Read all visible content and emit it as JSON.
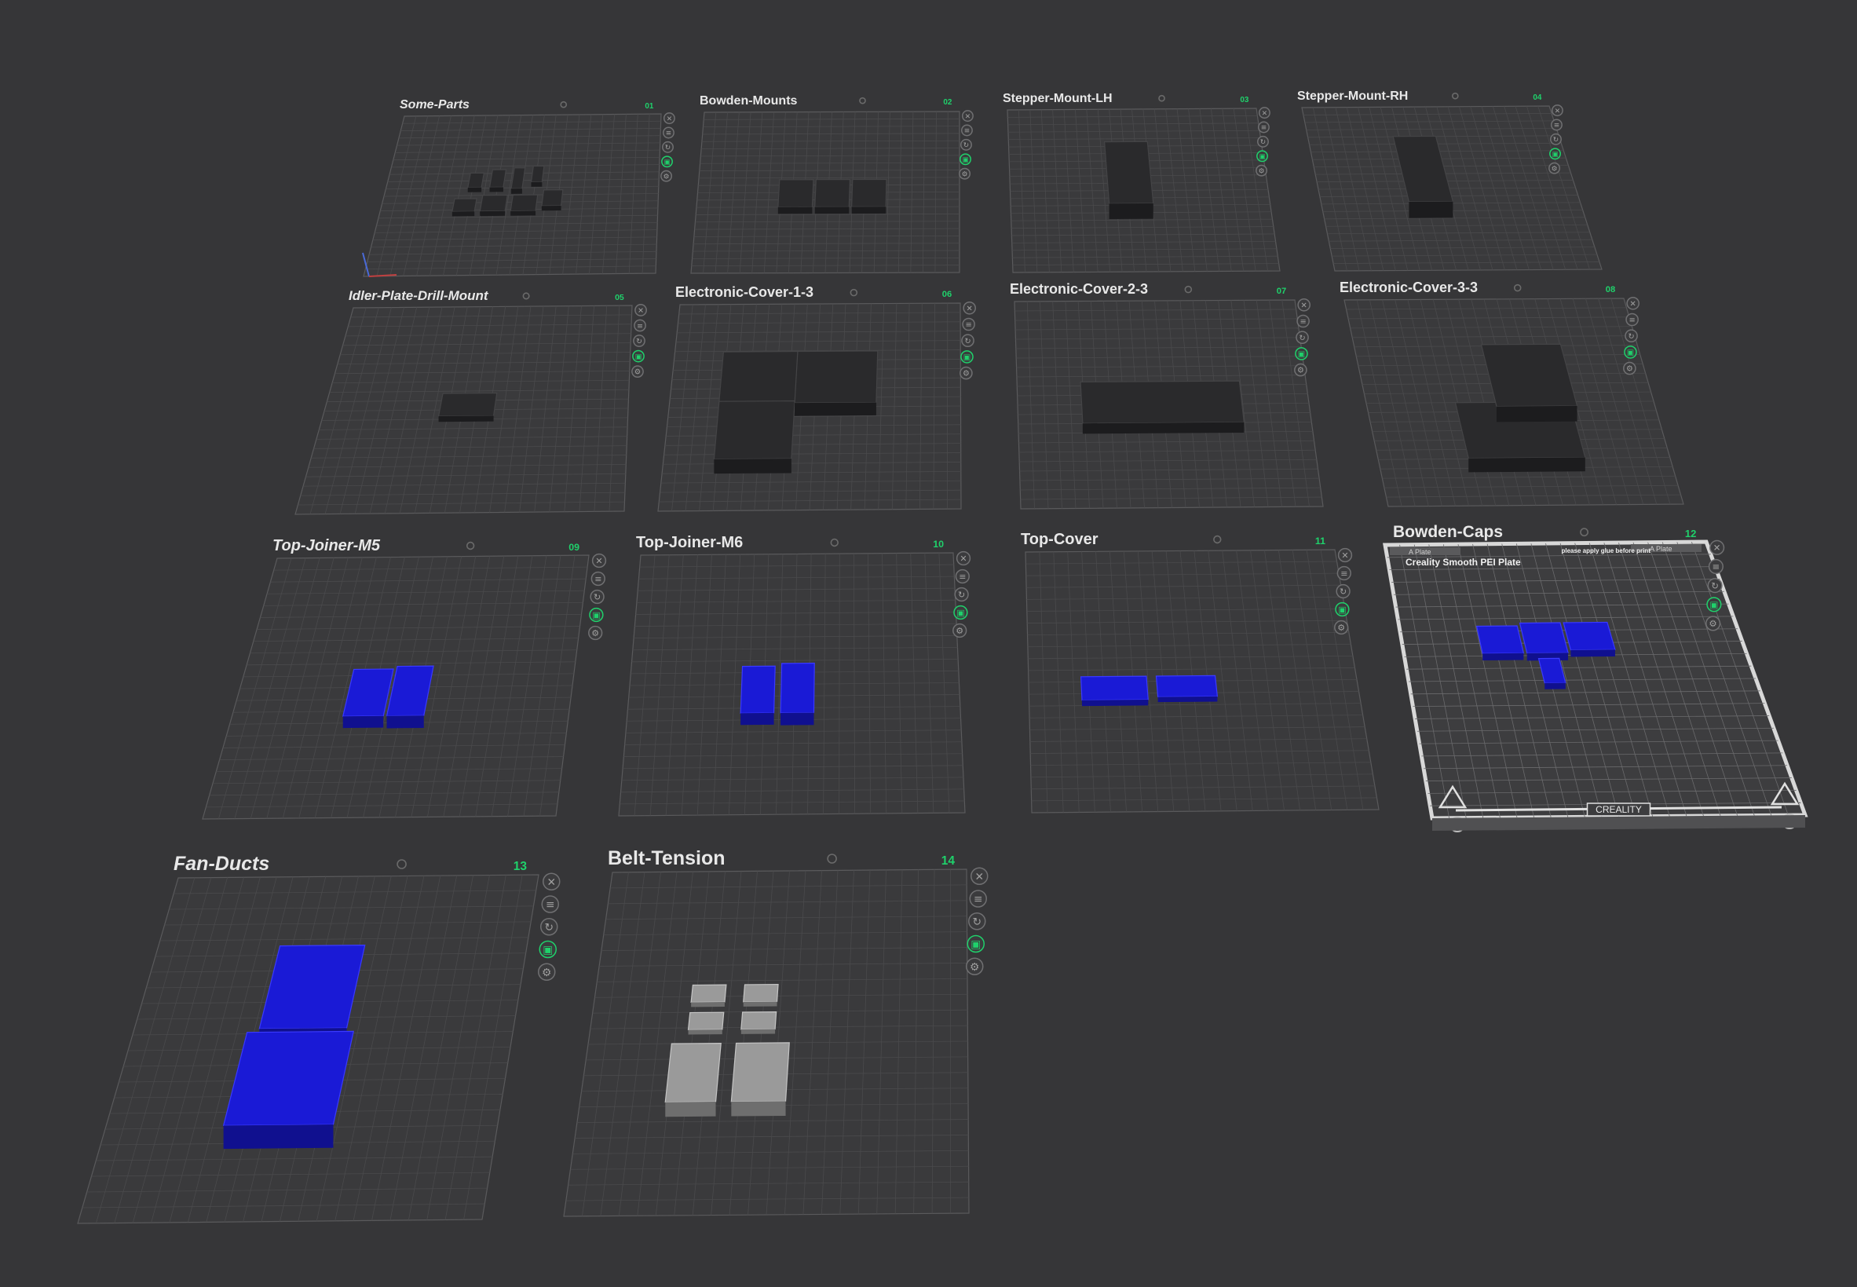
{
  "plates": [
    {
      "id": "plate-01",
      "name": "Some-Parts",
      "number": "01",
      "material": "dark"
    },
    {
      "id": "plate-02",
      "name": "Bowden-Mounts",
      "number": "02",
      "material": "dark"
    },
    {
      "id": "plate-03",
      "name": "Stepper-Mount-LH",
      "number": "03",
      "material": "dark"
    },
    {
      "id": "plate-04",
      "name": "Stepper-Mount-RH",
      "number": "04",
      "material": "dark"
    },
    {
      "id": "plate-05",
      "name": "Idler-Plate-Drill-Mount",
      "number": "05",
      "material": "dark"
    },
    {
      "id": "plate-06",
      "name": "Electronic-Cover-1-3",
      "number": "06",
      "material": "dark"
    },
    {
      "id": "plate-07",
      "name": "Electronic-Cover-2-3",
      "number": "07",
      "material": "dark"
    },
    {
      "id": "plate-08",
      "name": "Electronic-Cover-3-3",
      "number": "08",
      "material": "dark"
    },
    {
      "id": "plate-09",
      "name": "Top-Joiner-M5",
      "number": "09",
      "material": "blue"
    },
    {
      "id": "plate-10",
      "name": "Top-Joiner-M6",
      "number": "10",
      "material": "blue"
    },
    {
      "id": "plate-11",
      "name": "Top-Cover",
      "number": "11",
      "material": "blue"
    },
    {
      "id": "plate-12",
      "name": "Bowden-Caps",
      "number": "12",
      "material": "blue",
      "selected": true,
      "bed_label": "Creality Smooth PEI Plate",
      "bed_brand": "CREALITY",
      "bed_notice": "please apply glue before print",
      "bed_tab_left": "A Plate",
      "bed_tab_right": "A Plate"
    },
    {
      "id": "plate-13",
      "name": "Fan-Ducts",
      "number": "13",
      "material": "blue"
    },
    {
      "id": "plate-14",
      "name": "Belt-Tension",
      "number": "14",
      "material": "grey"
    }
  ],
  "toolbar_icons": [
    "close-icon",
    "arrange-icon",
    "orient-icon",
    "lock-icon",
    "settings-icon"
  ],
  "colors": {
    "background": "#363638",
    "grid_line": "#4a4a4c",
    "plate_edge": "#5a5a5c",
    "plate_number": "#1fd16b",
    "part_dark": "#2a2a2c",
    "part_blue": "#1a1ad6",
    "part_grey": "#9a9a9a",
    "selected_border": "#d8d8d8"
  }
}
